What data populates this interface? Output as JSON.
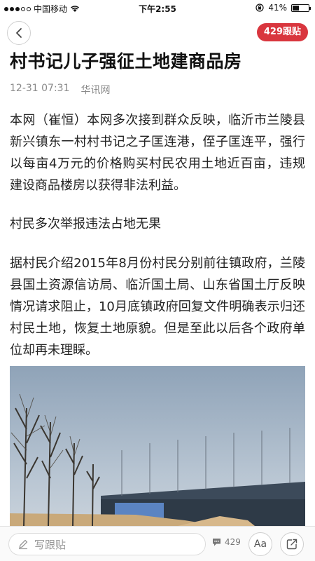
{
  "status_bar": {
    "carrier": "中国移动",
    "time": "下午2:55",
    "battery": "41%",
    "battery_level": 0.41
  },
  "nav": {
    "back_icon": "chevron-left-icon",
    "follow_count": "429跟贴"
  },
  "article": {
    "title": "村书记儿子强征土地建商品房",
    "date": "12-31 07:31",
    "source": "华讯网",
    "paragraph1": "本网（崔恒）本网多次接到群众反映，临沂市兰陵县新兴镇东一村村书记之子匡连港，侄子匡连平，强行以每亩4万元的价格购买村民农用土地近百亩，违规建设商品楼房以获得非法利益。",
    "subheading": "村民多次举报违法占地无果",
    "paragraph2": "据村民介绍2015年8月份村民分别前往镇政府，兰陵县国土资源信访局、临沂国土局、山东省国土厅反映情况请求阻止，10月底镇政府回复文件明确表示归还村民土地，恢复土地原貌。但是至此以后各个政府单位却再未理睬。"
  },
  "bottom_bar": {
    "input_placeholder": "写跟贴",
    "comment_count": "429",
    "font_button_label": "Aa",
    "colors": {
      "accent": "#d9363e"
    }
  }
}
